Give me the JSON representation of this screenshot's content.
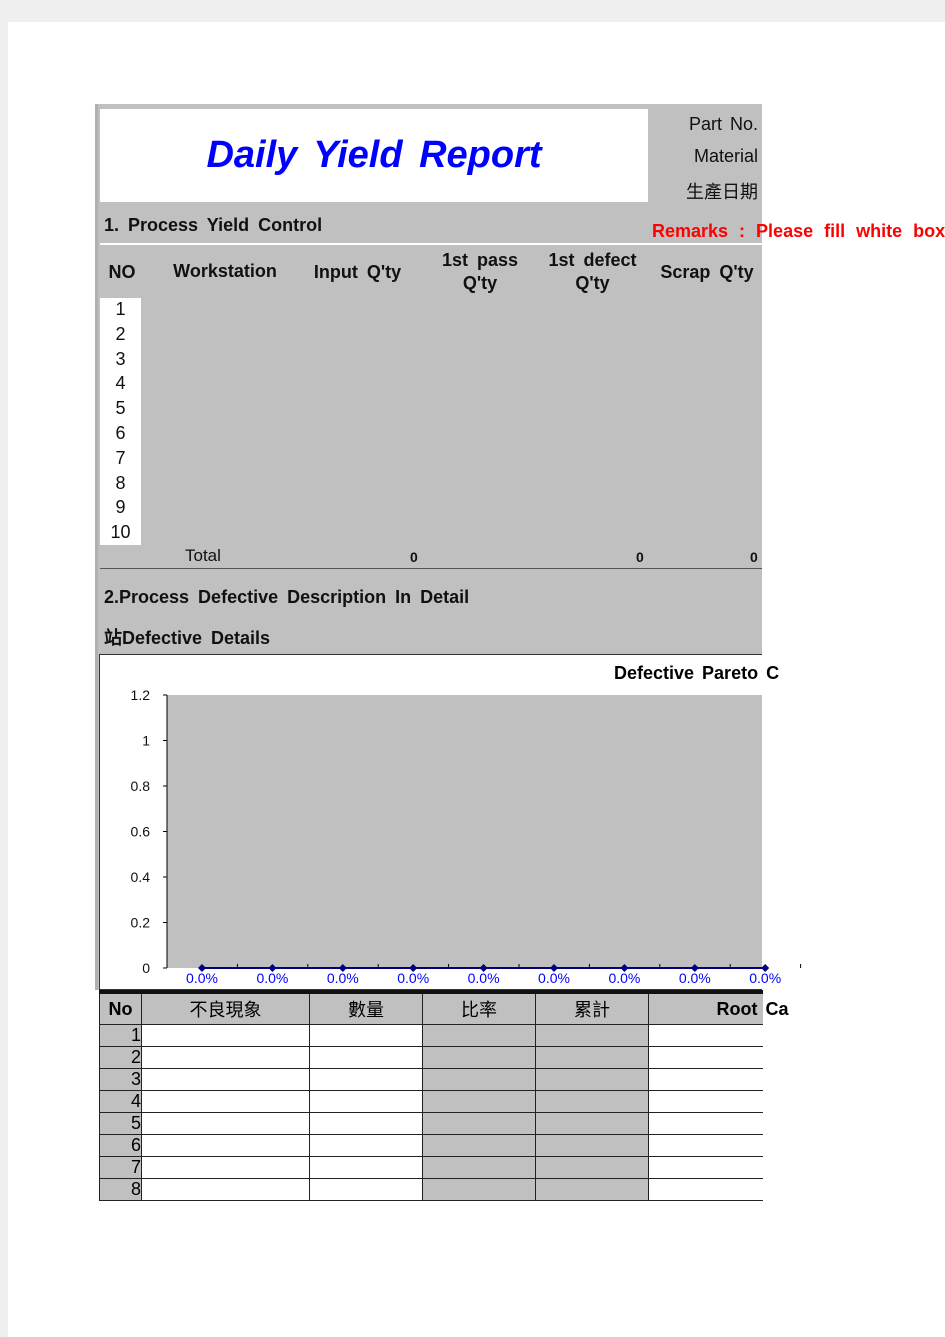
{
  "header": {
    "title": "Daily  Yield  Report",
    "meta_labels": [
      "Part  No.",
      "Material",
      "生產日期"
    ]
  },
  "section1": {
    "title": "1.  Process  Yield  Control",
    "remarks": "Remarks  :  Please  fill  white  box",
    "columns": [
      "NO",
      "Workstation",
      "Input  Q'ty",
      "1st  pass Q'ty",
      "1st  defect Q'ty",
      "Scrap  Q'ty"
    ],
    "rows": [
      "1",
      "2",
      "3",
      "4",
      "5",
      "6",
      "7",
      "8",
      "9",
      "10"
    ],
    "total_label": "Total",
    "totals": {
      "input": "0",
      "first_defect": "0",
      "scrap": "0"
    }
  },
  "section2": {
    "title": "2.Process  Defective  Description  In  Detail",
    "subtitle": "站Defective  Details"
  },
  "chart_data": {
    "type": "line",
    "title": "Defective  Pareto  C",
    "categories": [
      "0.0%",
      "0.0%",
      "0.0%",
      "0.0%",
      "0.0%",
      "0.0%",
      "0.0%",
      "0.0%",
      "0.0%"
    ],
    "values": [
      0,
      0,
      0,
      0,
      0,
      0,
      0,
      0,
      0
    ],
    "ylim": [
      0,
      1.2
    ],
    "yticks": [
      "0",
      "0.2",
      "0.4",
      "0.6",
      "0.8",
      "1",
      "1.2"
    ],
    "plot_bg": "#c0c0c0",
    "line_color": "#000080",
    "label_color": "#0000ff"
  },
  "defect_table": {
    "columns": [
      "No",
      "不良現象",
      "數量",
      "比率",
      "累計",
      "Root  Ca"
    ],
    "rows": [
      "1",
      "2",
      "3",
      "4",
      "5",
      "6",
      "7",
      "8"
    ]
  }
}
